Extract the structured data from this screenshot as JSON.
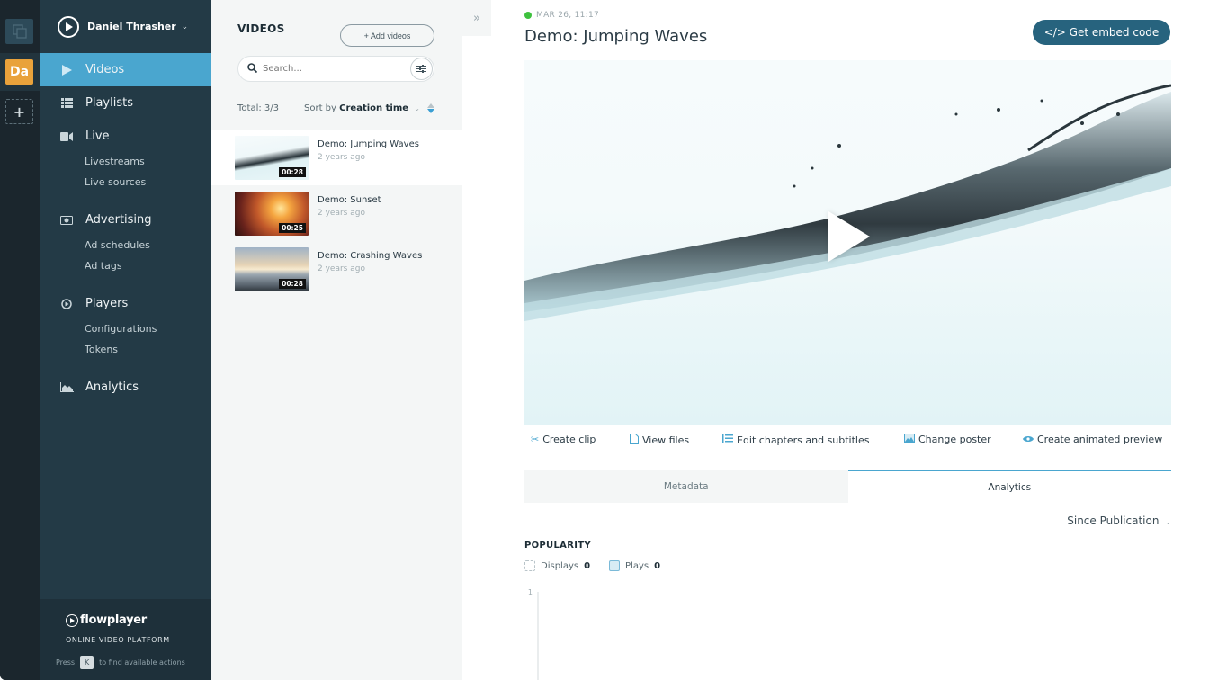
{
  "workspaces": [
    {
      "name": "workspace-switcher",
      "label": ""
    },
    {
      "name": "workspace-da",
      "label": "Da"
    },
    {
      "name": "add-workspace",
      "label": "+"
    }
  ],
  "nav": {
    "user": "Daniel Thrasher",
    "items": [
      {
        "label": "Videos",
        "icon": "play-icon",
        "active": true
      },
      {
        "label": "Playlists",
        "icon": "list-icon"
      },
      {
        "label": "Live",
        "icon": "camera-icon",
        "sub": [
          "Livestreams",
          "Live sources"
        ]
      },
      {
        "label": "Advertising",
        "icon": "money-icon",
        "sub": [
          "Ad schedules",
          "Ad tags"
        ]
      },
      {
        "label": "Players",
        "icon": "player-icon",
        "sub": [
          "Configurations",
          "Tokens"
        ]
      },
      {
        "label": "Analytics",
        "icon": "chart-icon"
      }
    ],
    "footer": {
      "brand": "flowplayer",
      "tagline": "ONLINE VIDEO PLATFORM",
      "hint_prefix": "Press",
      "hint_key": "K",
      "hint_suffix": "to find available actions"
    }
  },
  "list": {
    "title": "VIDEOS",
    "add_label": "+ Add videos",
    "search_placeholder": "Search...",
    "total": "Total: 3/3",
    "sort_prefix": "Sort by",
    "sort_value": "Creation time",
    "videos": [
      {
        "title": "Demo: Jumping Waves",
        "age": "2 years ago",
        "duration": "00:28",
        "selected": true
      },
      {
        "title": "Demo: Sunset",
        "age": "2 years ago",
        "duration": "00:25"
      },
      {
        "title": "Demo: Crashing Waves",
        "age": "2 years ago",
        "duration": "00:28"
      }
    ]
  },
  "detail": {
    "status_color": "#3ec13e",
    "date": "MAR 26, 11:17",
    "title": "Demo: Jumping Waves",
    "embed_label": "</> Get embed code",
    "actions": [
      {
        "label": "Create clip",
        "icon": "scissors-icon"
      },
      {
        "label": "View files",
        "icon": "file-icon"
      },
      {
        "label": "Edit chapters and subtitles",
        "icon": "chapters-icon"
      },
      {
        "label": "Change poster",
        "icon": "image-icon"
      },
      {
        "label": "Create animated preview",
        "icon": "eye-icon"
      }
    ],
    "tabs": [
      {
        "label": "Metadata",
        "active": false
      },
      {
        "label": "Analytics",
        "active": true
      }
    ],
    "range": "Since Publication",
    "popularity": {
      "title": "POPULARITY",
      "displays_label": "Displays",
      "displays_value": "0",
      "plays_label": "Plays",
      "plays_value": "0",
      "y_tick": "1"
    }
  },
  "colors": {
    "accent": "#4aa6cf",
    "embed_button": "#27637e",
    "nav_bg": "#233a46",
    "workspace_badge": "#e9a23b"
  }
}
